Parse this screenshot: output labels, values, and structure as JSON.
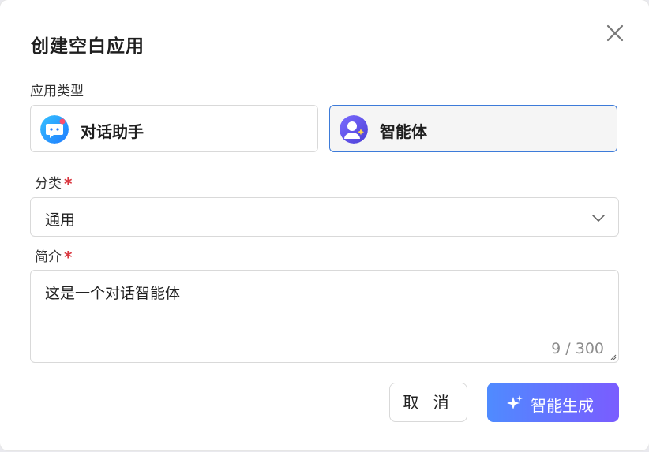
{
  "dialog": {
    "title": "创建空白应用",
    "app_type_label": "应用类型",
    "app_types": [
      {
        "label": "对话助手",
        "selected": false,
        "icon": "chat-bubble-icon"
      },
      {
        "label": "智能体",
        "selected": true,
        "icon": "agent-avatar-icon"
      }
    ],
    "category": {
      "label": "分类",
      "required_mark": "*",
      "value": "通用"
    },
    "intro": {
      "label": "简介",
      "required_mark": "*",
      "value": "这是一个对话智能体",
      "counter": "9 / 300"
    },
    "buttons": {
      "cancel": "取 消",
      "generate": "智能生成"
    }
  },
  "colors": {
    "primary_border": "#3d7bd9",
    "required": "#d9363e",
    "gradient_start": "#4f8bff",
    "gradient_end": "#7a5cff"
  }
}
